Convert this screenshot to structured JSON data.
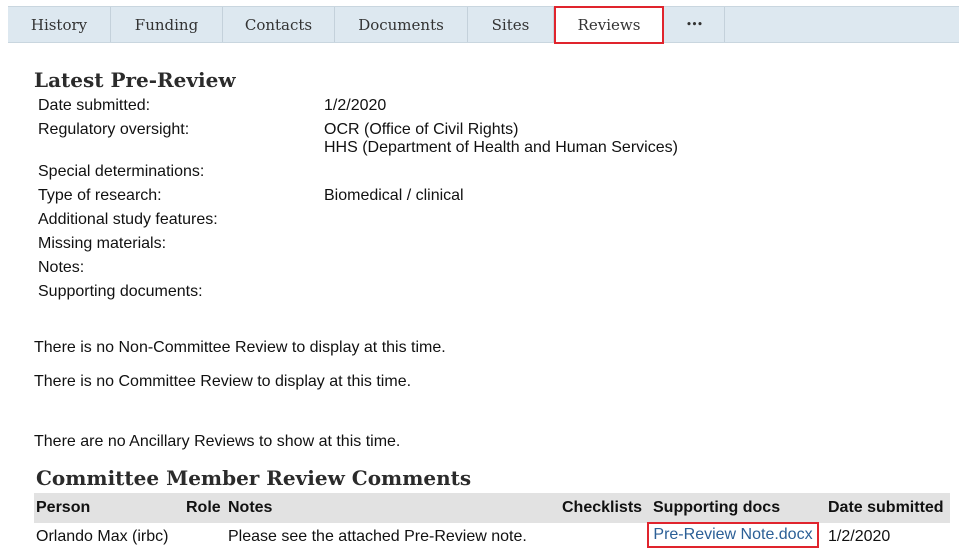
{
  "tabs": [
    {
      "label": "History"
    },
    {
      "label": "Funding"
    },
    {
      "label": "Contacts"
    },
    {
      "label": "Documents"
    },
    {
      "label": "Sites"
    },
    {
      "label": "Reviews",
      "active": true
    },
    {
      "label": "•••"
    }
  ],
  "pre_review": {
    "title": "Latest Pre-Review",
    "fields": [
      {
        "label": "Date submitted:",
        "value": "1/2/2020"
      },
      {
        "label": "Regulatory oversight:",
        "value": "OCR (Office of Civil Rights)",
        "value2": "HHS (Department of Health and Human Services)"
      },
      {
        "label": "Special determinations:",
        "value": ""
      },
      {
        "label": "Type of research:",
        "value": "Biomedical / clinical"
      },
      {
        "label": "Additional study features:",
        "value": ""
      },
      {
        "label": "Missing materials:",
        "value": ""
      },
      {
        "label": "Notes:",
        "value": ""
      },
      {
        "label": "Supporting documents:",
        "value": ""
      }
    ]
  },
  "messages": {
    "non_committee": "There is no Non-Committee Review to display at this time.",
    "committee": "There is no Committee Review to display at this time.",
    "ancillary": "There are no Ancillary Reviews to show at this time."
  },
  "comments": {
    "title": "Committee Member Review Comments",
    "columns": {
      "person": "Person",
      "role": "Role",
      "notes": "Notes",
      "checklists": "Checklists",
      "supporting_docs": "Supporting docs",
      "date_submitted": "Date submitted"
    },
    "rows": [
      {
        "person": "Orlando Max (irbc)",
        "role": "",
        "notes": "Please see the attached Pre-Review note.",
        "checklists": "",
        "supporting_doc": "Pre-Review Note.docx",
        "date_submitted": "1/2/2020"
      }
    ]
  },
  "colors": {
    "tabbar_bg": "#dde8f0",
    "highlight": "#e0242d",
    "link": "#2b5f96",
    "table_header_bg": "#e2e2e2"
  }
}
